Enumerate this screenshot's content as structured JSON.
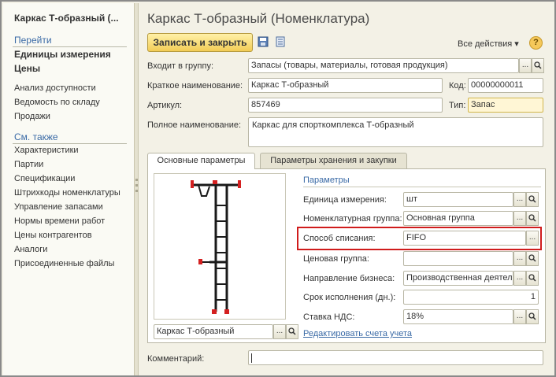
{
  "nav": {
    "title": "Каркас Т-образный (...",
    "go_heading": "Перейти",
    "bold_items": [
      "Единицы измерения",
      "Цены"
    ],
    "items": [
      "Анализ доступности",
      "Ведомость по складу",
      "Продажи"
    ],
    "see_also_heading": "См. также",
    "see_also_items": [
      "Характеристики",
      "Партии",
      "Спецификации",
      "Штрихкоды номенклатуры",
      "Управление запасами",
      "Нормы времени работ",
      "Цены контрагентов",
      "Аналоги",
      "Присоединенные файлы"
    ]
  },
  "form": {
    "title": "Каркас Т-образный (Номенклатура)",
    "save_close": "Записать и закрыть",
    "all_actions": "Все действия ▾",
    "help": "?",
    "icons": {
      "save": "save-icon",
      "list": "list-icon"
    },
    "group_label": "Входит в группу:",
    "group_value": "Запасы (товары, материалы, готовая продукция)",
    "short_name_label": "Краткое наименование:",
    "short_name_value": "Каркас Т-образный",
    "code_label": "Код:",
    "code_value": "00000000011",
    "article_label": "Артикул:",
    "article_value": "857469",
    "type_label": "Тип:",
    "type_value": "Запас",
    "full_name_label": "Полное наименование:",
    "full_name_value": "Каркас для спорткомплекса Т-образный",
    "comment_label": "Комментарий:",
    "comment_value": ""
  },
  "tabs": [
    "Основные параметры",
    "Параметры хранения и закупки"
  ],
  "params": {
    "heading": "Параметры",
    "unit_label": "Единица измерения:",
    "unit_value": "шт",
    "group_label": "Номенклатурная группа:",
    "group_value": "Основная группа",
    "writeoff_label": "Способ списания:",
    "writeoff_value": "FIFO",
    "price_group_label": "Ценовая группа:",
    "price_group_value": "",
    "business_label": "Направление бизнеса:",
    "business_value": "Производственная деятел",
    "term_label": "Срок исполнения (дн.):",
    "term_value": "1",
    "vat_label": "Ставка НДС:",
    "vat_value": "18%",
    "edit_vat_link": "Редактировать счета учета",
    "picture_caption": "Каркас Т-образный"
  },
  "buttons": {
    "choose": "...",
    "search": "🔍"
  },
  "colors": {
    "accent": "#3a6aa6",
    "primary_button": "#f2cc55",
    "highlight": "#d01c1c"
  }
}
